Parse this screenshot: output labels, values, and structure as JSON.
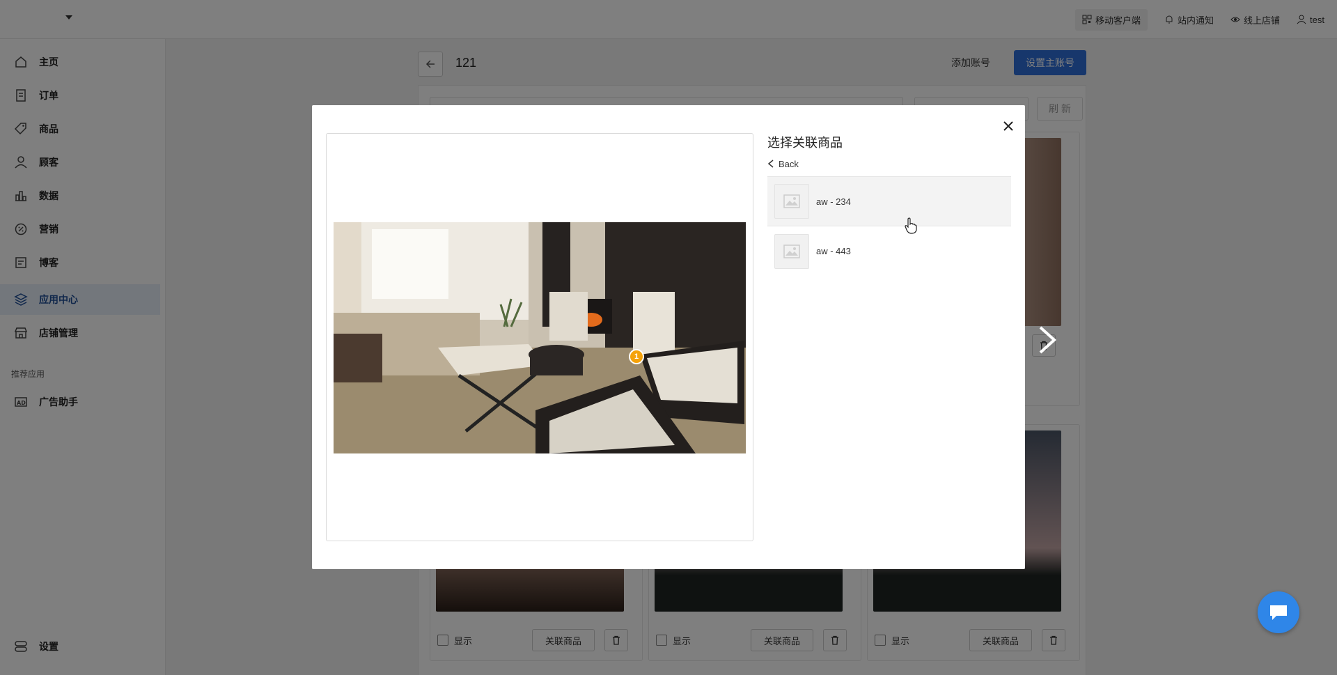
{
  "topbar": {
    "store_name": "",
    "links": [
      {
        "label": "移动客户端",
        "icon": "qrcode-icon"
      },
      {
        "label": "站内通知",
        "icon": "bell-icon"
      },
      {
        "label": "线上店铺",
        "icon": "eye-icon"
      },
      {
        "label": "test",
        "icon": "user-icon"
      }
    ]
  },
  "sidebar": {
    "items": [
      {
        "label": "主页",
        "icon": "home-icon"
      },
      {
        "label": "订单",
        "icon": "receipt-icon"
      },
      {
        "label": "商品",
        "icon": "tag-icon"
      },
      {
        "label": "顾客",
        "icon": "person-icon"
      },
      {
        "label": "数据",
        "icon": "chart-icon"
      },
      {
        "label": "营销",
        "icon": "discount-icon"
      },
      {
        "label": "博客",
        "icon": "blog-icon"
      },
      {
        "label": "应用中心",
        "icon": "layers-icon"
      },
      {
        "label": "店铺管理",
        "icon": "store-icon"
      }
    ],
    "section_label": "推荐应用",
    "recommended": [
      {
        "label": "广告助手",
        "icon": "ad-icon"
      }
    ],
    "settings_label": "设置"
  },
  "page": {
    "title": "121",
    "add_account": "添加账号",
    "set_primary": "设置主账号",
    "refresh": "刷 新",
    "card_show_label": "显示",
    "card_link_label": "关联商品"
  },
  "modal": {
    "title": "选择关联商品",
    "back_label": "Back",
    "hotspot_number": "1",
    "products": [
      {
        "name": "aw - 234"
      },
      {
        "name": "aw - 443"
      }
    ]
  },
  "colors": {
    "primary": "#2f6fd8",
    "hotspot": "#f5a20a",
    "active_nav_bg": "#e6eef9",
    "chat_fab": "#2f86e8"
  }
}
